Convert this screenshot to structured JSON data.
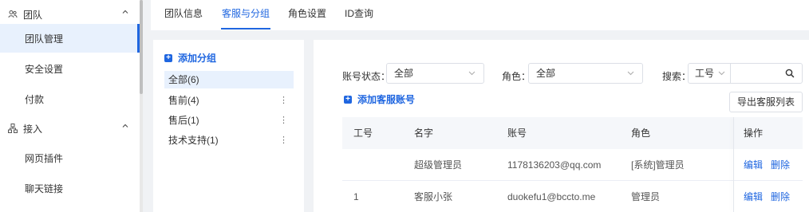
{
  "sidebar": {
    "groups": [
      {
        "label": "团队",
        "icon": "team-icon",
        "expanded": true,
        "items": [
          "团队管理",
          "安全设置",
          "付款"
        ]
      },
      {
        "label": "接入",
        "icon": "network-icon",
        "expanded": true,
        "items": [
          "网页插件",
          "聊天链接"
        ]
      }
    ],
    "active_item": "团队管理"
  },
  "tabs": [
    "团队信息",
    "客服与分组",
    "角色设置",
    "ID查询"
  ],
  "active_tab": "客服与分组",
  "groups_panel": {
    "add_label": "添加分组",
    "items": [
      {
        "label": "全部(6)",
        "active": true,
        "menu": false
      },
      {
        "label": "售前(4)",
        "active": false,
        "menu": true
      },
      {
        "label": "售后(1)",
        "active": false,
        "menu": true
      },
      {
        "label": "技术支持(1)",
        "active": false,
        "menu": true
      }
    ],
    "menu_glyph": "⋮"
  },
  "filters": {
    "status_label": "账号状态：",
    "status_value": "全部",
    "role_label": "角色：",
    "role_value": "全部",
    "search_label": "搜索：",
    "search_type": "工号",
    "search_placeholder": ""
  },
  "actions": {
    "add_account": "添加客服账号",
    "export": "导出客服列表"
  },
  "table": {
    "columns": [
      "工号",
      "名字",
      "账号",
      "角色",
      "操作"
    ],
    "rows": [
      {
        "id": "",
        "name": "超级管理员",
        "account": "1178136203@qq.com",
        "role": "[系统]管理员",
        "edit": "编辑",
        "delete": "删除"
      },
      {
        "id": "1",
        "name": "客服小张",
        "account": "duokefu1@bccto.me",
        "role": "管理员",
        "edit": "编辑",
        "delete": "删除"
      }
    ]
  },
  "colors": {
    "accent": "#1f66e0",
    "active_bg": "#e8f1fd",
    "page_bg": "#f0f2f5"
  }
}
